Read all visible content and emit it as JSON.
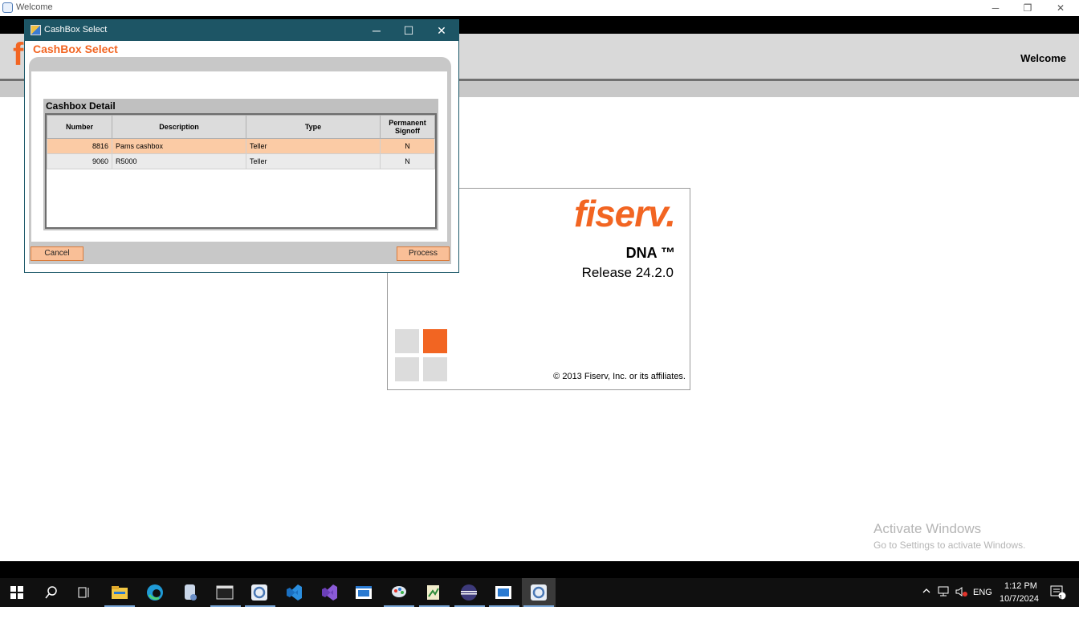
{
  "outer_window": {
    "title": "Welcome",
    "minimize": "─",
    "restore": "❐",
    "close": "✕"
  },
  "header": {
    "logo_letter": "f",
    "welcome": "Welcome"
  },
  "splash": {
    "brand": "fiserv.",
    "product": "DNA ™",
    "release": "Release 24.2.0",
    "copyright": "© 2013 Fiserv, Inc. or its affiliates."
  },
  "dialog": {
    "title": "CashBox Select",
    "heading": "CashBox Select",
    "minimize": "─",
    "maximize": "☐",
    "close": "✕",
    "group_title": "Cashbox Detail",
    "columns": [
      "Number",
      "Description",
      "Type",
      "Permanent Signoff"
    ],
    "rows": [
      {
        "number": "8816",
        "description": "Pams cashbox",
        "type": "Teller",
        "signoff": "N"
      },
      {
        "number": "9060",
        "description": "R5000",
        "type": "Teller",
        "signoff": "N"
      }
    ],
    "cancel_label": "Cancel",
    "process_label": "Process"
  },
  "watermark": {
    "line1": "Activate Windows",
    "line2": "Go to Settings to activate Windows."
  },
  "taskbar": {
    "icons": [
      "start-icon",
      "search-icon",
      "task-view-icon",
      "file-explorer-icon",
      "edge-icon",
      "app-icon",
      "terminal-icon",
      "dna-app-icon",
      "vscode-icon",
      "visual-studio-icon",
      "window-app-icon",
      "paint-icon",
      "script-icon",
      "eclipse-icon",
      "remote-desktop-icon",
      "dna-active-icon"
    ],
    "lang": "ENG",
    "time": "1:12 PM",
    "date": "10/7/2024",
    "notification_count": "1"
  },
  "colors": {
    "accent": "#f26522",
    "dialog_titlebar": "#1d5565",
    "selected_row": "#fbcba5"
  }
}
